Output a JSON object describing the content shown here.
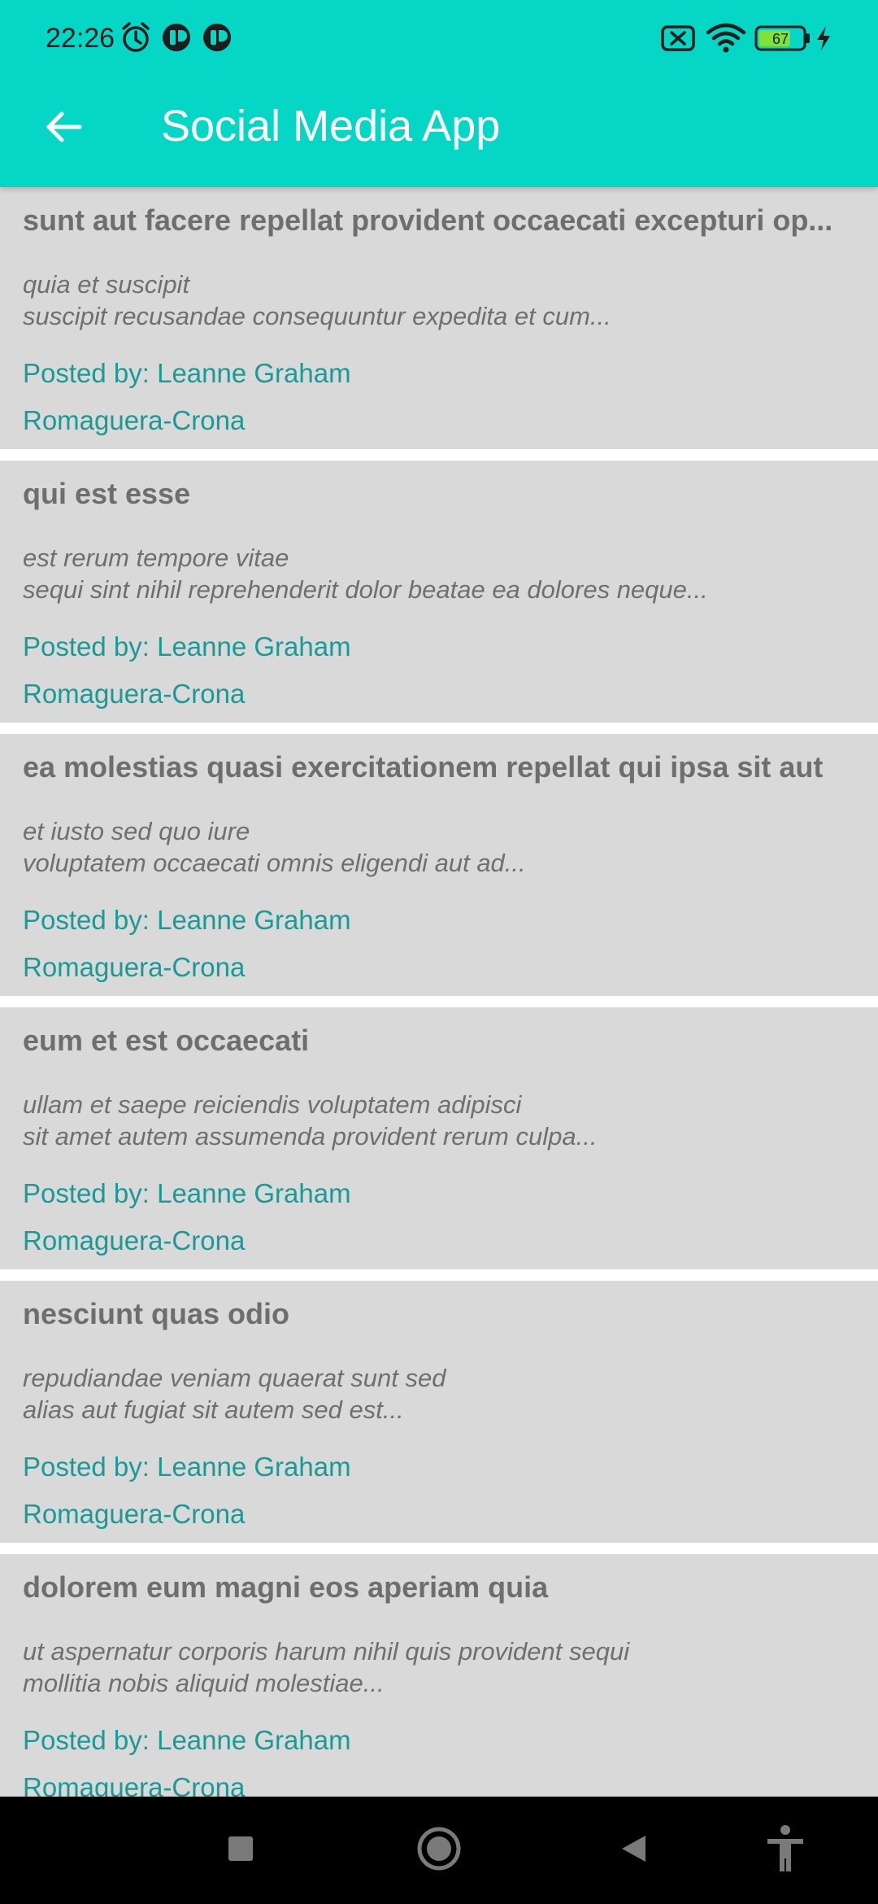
{
  "status_bar": {
    "time": "22:26",
    "battery_level": "67",
    "icons": [
      "alarm-icon",
      "app-notification-icon",
      "app-notification-icon",
      "sim-off-icon",
      "wifi-icon",
      "battery-icon",
      "charging-icon"
    ]
  },
  "app_bar": {
    "title": "Social Media App",
    "back_icon": "arrow-left-icon"
  },
  "colors": {
    "accent": "#06d6c6",
    "card_background": "#d9d9d9",
    "link_text": "#1a9a96",
    "title_text": "#6e6e6e"
  },
  "posts": [
    {
      "title": "sunt aut facere repellat provident occaecati excepturi op...",
      "body": "quia et suscipit\nsuscipit recusandae consequuntur expedita et cum...",
      "author": "Posted by: Leanne Graham",
      "company": "Romaguera-Crona"
    },
    {
      "title": "qui est esse",
      "body": "est rerum tempore vitae\nsequi sint nihil reprehenderit dolor beatae ea dolores neque...",
      "author": "Posted by: Leanne Graham",
      "company": "Romaguera-Crona"
    },
    {
      "title": "ea molestias quasi exercitationem repellat qui ipsa sit aut",
      "body": "et iusto sed quo iure\nvoluptatem occaecati omnis eligendi aut ad...",
      "author": "Posted by: Leanne Graham",
      "company": "Romaguera-Crona"
    },
    {
      "title": "eum et est occaecati",
      "body": "ullam et saepe reiciendis voluptatem adipisci\nsit amet autem assumenda provident rerum culpa...",
      "author": "Posted by: Leanne Graham",
      "company": "Romaguera-Crona"
    },
    {
      "title": "nesciunt quas odio",
      "body": "repudiandae veniam quaerat sunt sed\nalias aut fugiat sit autem sed est...",
      "author": "Posted by: Leanne Graham",
      "company": "Romaguera-Crona"
    },
    {
      "title": "dolorem eum magni eos aperiam quia",
      "body": "ut aspernatur corporis harum nihil quis provident sequi\nmollitia nobis aliquid molestiae...",
      "author": "Posted by: Leanne Graham",
      "company": "Romaguera-Crona"
    }
  ],
  "nav_bar": {
    "icons": [
      "recent-apps-icon",
      "home-icon",
      "back-icon",
      "accessibility-icon"
    ]
  }
}
